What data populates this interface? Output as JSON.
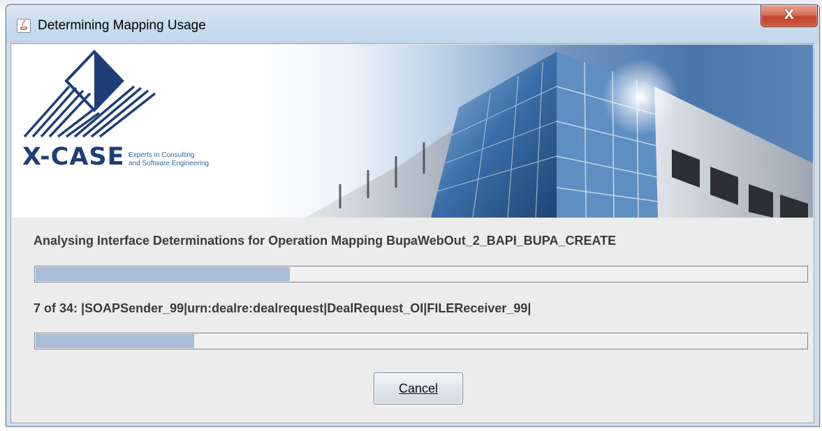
{
  "window": {
    "title": "Determining Mapping Usage",
    "close_label": "X"
  },
  "banner": {
    "logo_text": "X-CASE",
    "tagline_line1": "Experts in Consulting",
    "tagline_line2": "and Software Engineering"
  },
  "progress": {
    "operation_text": "Analysing Interface Determinations for Operation Mapping BupaWebOut_2_BAPI_BUPA_CREATE",
    "operation_fraction": 0.33,
    "item_text": "7 of 34: |SOAPSender_99|urn:dealre:dealrequest|DealRequest_OI|FILEReceiver_99|",
    "item_fraction": 0.2059
  },
  "buttons": {
    "cancel_label": "Cancel"
  },
  "icons": {
    "app": "java-app-icon",
    "close": "close-icon"
  },
  "colors": {
    "progress_fill": "#a9bdd6",
    "logo_blue": "#1d3e78",
    "close_red": "#c3442b"
  }
}
